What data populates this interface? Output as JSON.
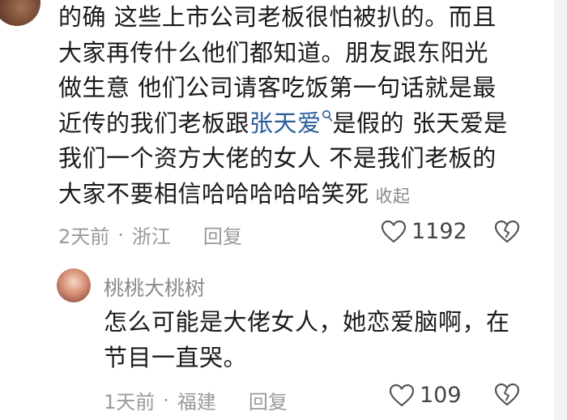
{
  "main_comment": {
    "line1": "的确 这些上市公司老板很怕被扒的。而且",
    "line2": "大家再传什么他们都知道。朋友跟东阳光",
    "line3": "做生意 他们公司请客吃饭第一句话就是最",
    "line4_prefix": "近传的我们老板跟",
    "mention": "张天爱",
    "line4_suffix": "是假的 张天爱是",
    "line5": "我们一个资方大佬的女人 不是我们老板的",
    "line6": "大家不要相信哈哈哈哈哈笑死",
    "collapse_label": "收起",
    "time": "2天前",
    "location": "浙江",
    "reply_label": "回复",
    "likes": "1192"
  },
  "reply_comment": {
    "username": "桃桃大桃树",
    "line1": "怎么可能是大佬女人，她恋爱脑啊，在",
    "line2": "节目一直哭。",
    "time": "1天前",
    "location": "福建",
    "reply_label": "回复",
    "likes": "109"
  },
  "separator": "·"
}
